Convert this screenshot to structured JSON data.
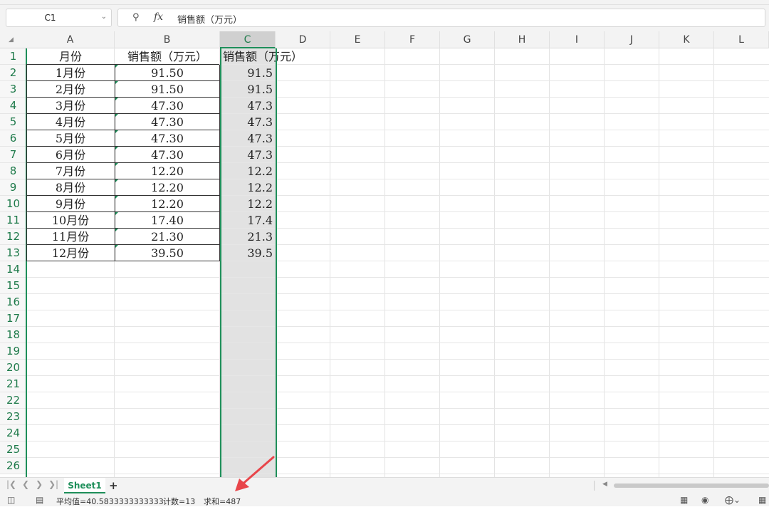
{
  "formula_bar": {
    "name_box": "C1",
    "fx_label": "fx",
    "content": "销售额（万元）"
  },
  "columns": [
    "A",
    "B",
    "C",
    "D",
    "E",
    "F",
    "G",
    "H",
    "I",
    "J",
    "K",
    "L"
  ],
  "rows": [
    "1",
    "2",
    "3",
    "4",
    "5",
    "6",
    "7",
    "8",
    "9",
    "10",
    "11",
    "12",
    "13",
    "14",
    "15",
    "16",
    "17",
    "18",
    "19",
    "20",
    "21",
    "22",
    "23",
    "24",
    "25",
    "26"
  ],
  "cells": {
    "A1": "月份",
    "B1": "销售额（万元）",
    "C1": "销售额（万元）",
    "A": [
      "1月份",
      "2月份",
      "3月份",
      "4月份",
      "5月份",
      "6月份",
      "7月份",
      "8月份",
      "9月份",
      "10月份",
      "11月份",
      "12月份"
    ],
    "B": [
      "91.50",
      "91.50",
      "47.30",
      "47.30",
      "47.30",
      "47.30",
      "12.20",
      "12.20",
      "12.20",
      "17.40",
      "21.30",
      "39.50"
    ],
    "C": [
      "91.5",
      "91.5",
      "47.3",
      "47.3",
      "47.3",
      "47.3",
      "12.2",
      "12.2",
      "12.2",
      "17.4",
      "21.3",
      "39.5"
    ]
  },
  "sheets": {
    "tabs": [
      "Sheet1"
    ],
    "add": "+"
  },
  "status": {
    "average": "平均值=40.5833333333333",
    "count": "计数=13",
    "sum": "求和=487"
  },
  "colors": {
    "accent": "#1e8f5a",
    "selection_fill": "#e2e2e2",
    "annotation_arrow": "#e8454a"
  }
}
